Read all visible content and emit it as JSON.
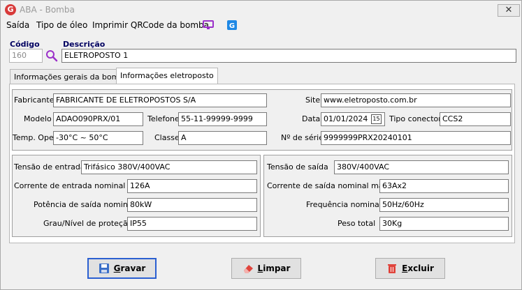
{
  "window": {
    "title": "ABA - Bomba",
    "app_icon": "G",
    "close_glyph": "✕"
  },
  "menu": {
    "items": [
      "Saída",
      "Tipo de óleo",
      "Imprimir QRCode da bomba"
    ]
  },
  "header": {
    "codigo_label": "Código",
    "codigo_value": "160",
    "descricao_label": "Descrição",
    "descricao_value": "ELETROPOSTO 1"
  },
  "tabs": [
    {
      "label": "Informações gerais da bomba",
      "active": false
    },
    {
      "label": "Informações eletroposto",
      "active": true
    }
  ],
  "general": {
    "fabricante_label": "Fabricante",
    "fabricante": "FABRICANTE DE ELETROPOSTOS S/A",
    "site_label": "Site",
    "site": "www.eletroposto.com.br",
    "modelo_label": "Modelo",
    "modelo": "ADAO090PRX/01",
    "telefone_label": "Telefone",
    "telefone": "55-11-99999-9999",
    "data_label": "Data",
    "data": "01/01/2024",
    "calendar_glyph": "15",
    "tipo_conector_label": "Tipo conector",
    "tipo_conector": "CCS2",
    "temp_label": "Temp. Ope.",
    "temp": "-30°C ~ 50°C",
    "classe_label": "Classe",
    "classe": "A",
    "serie_label": "Nº de série",
    "serie": "9999999PRX20240101"
  },
  "entrada": {
    "tensao_label": "Tensão de entrada",
    "tensao": "Trifásico 380V/400VAC",
    "corrente_label": "Corrente de entrada nominal máx.",
    "corrente": "126A",
    "potencia_label": "Potência de saída nominal",
    "potencia": "80kW",
    "grau_label": "Grau/Nível de proteção",
    "grau": "IP55"
  },
  "saida": {
    "tensao_label": "Tensão de saída",
    "tensao": "380V/400VAC",
    "corrente_label": "Corrente de saída nominal máx.",
    "corrente": "63Ax2",
    "frequencia_label": "Frequência nominal",
    "frequencia": "50Hz/60Hz",
    "peso_label": "Peso total",
    "peso": "30Kg"
  },
  "buttons": {
    "gravar_prefix": "",
    "gravar_u": "G",
    "gravar_rest": "ravar",
    "limpar_u": "L",
    "limpar_rest": "impar",
    "excluir_u": "E",
    "excluir_rest": "xcluir"
  },
  "colors": {
    "accent": "#2a5fd1",
    "brand": "#d83a3a",
    "label_dark": "#000060"
  }
}
